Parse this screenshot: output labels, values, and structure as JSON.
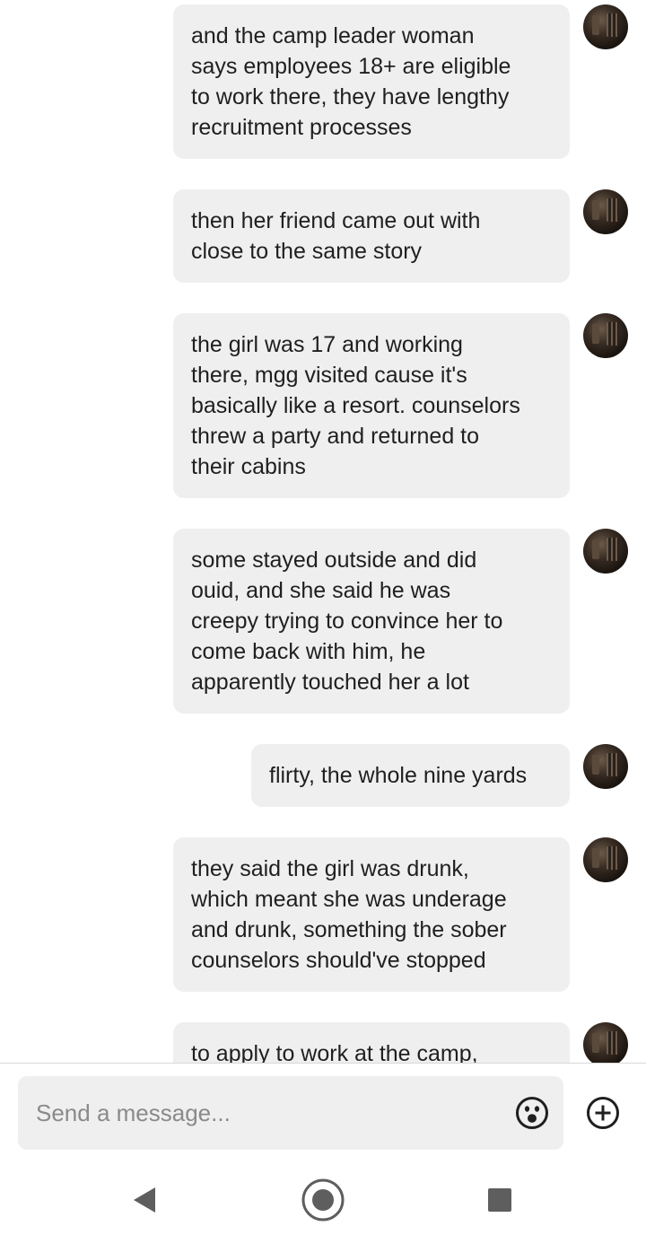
{
  "messages": [
    {
      "text": "and the camp leader woman\nsays employees 18+ are eligible\nto work there, they have lengthy\nrecruitment processes"
    },
    {
      "text": "then her friend came out with\nclose to the same story"
    },
    {
      "text": "the girl was 17 and working\nthere, mgg visited cause it's\nbasically like a resort. counselors\nthrew a party and returned to\ntheir cabins"
    },
    {
      "text": "some stayed outside and did\nouid, and she said he was\ncreepy trying to convince her to\ncome back with him, he\napparently touched her a lot"
    },
    {
      "text": "flirty, the whole nine yards"
    },
    {
      "text": "they said the girl was drunk,\nwhich meant she was underage\nand drunk, something the sober\ncounselors should've stopped"
    },
    {
      "text": "to apply to work at the camp,"
    }
  ],
  "composer": {
    "placeholder": "Send a message..."
  },
  "icons": {
    "emoji": "emoji-face-icon",
    "add": "plus-circle-icon",
    "nav_back": "triangle-back-icon",
    "nav_home": "circle-home-icon",
    "nav_recents": "square-recents-icon"
  },
  "colors": {
    "bubble": "#efefef",
    "text": "#1f1f1f",
    "placeholder": "#8a8a8a"
  }
}
